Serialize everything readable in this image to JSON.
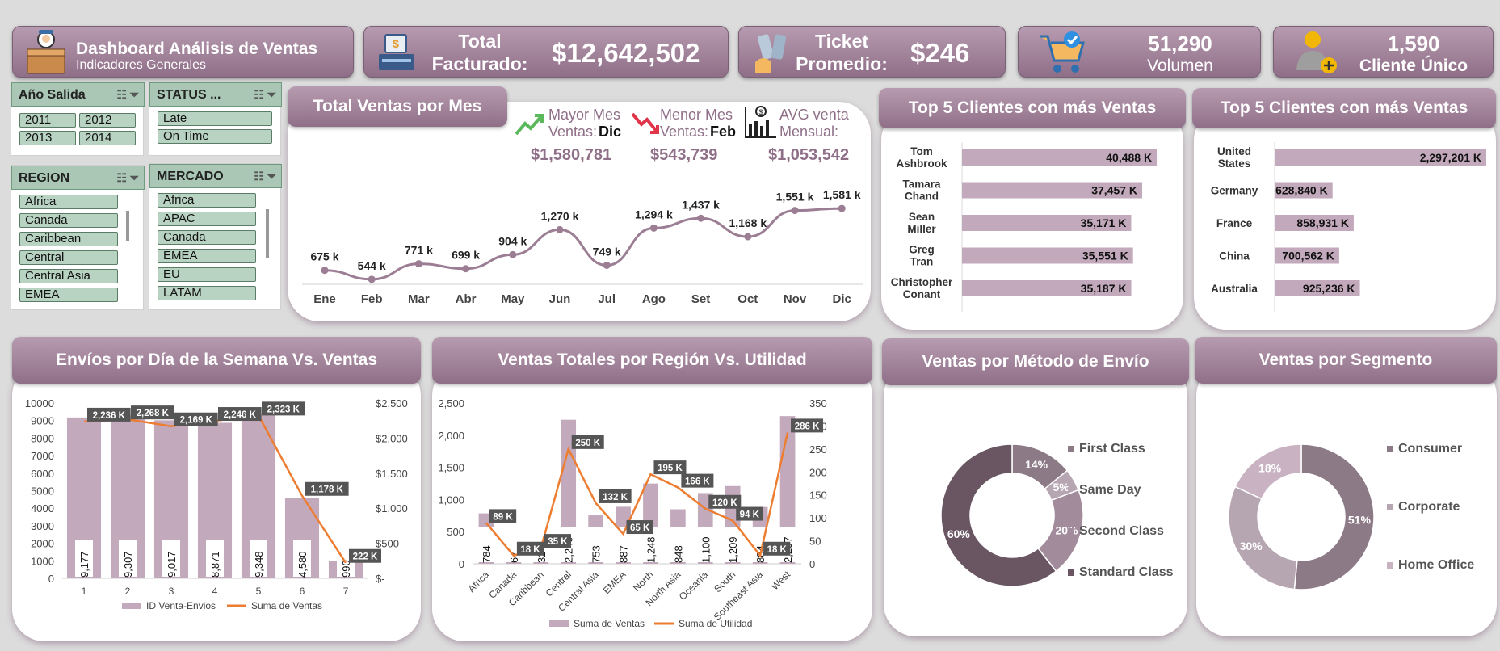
{
  "header": {
    "title": "Dashboard Análisis de Ventas",
    "subtitle": "Indicadores Generales"
  },
  "kpis": {
    "total": {
      "label1": "Total",
      "label2": "Facturado:",
      "value": "$12,642,502"
    },
    "ticket": {
      "label1": "Ticket",
      "label2": "Promedio:",
      "value": "$246"
    },
    "volumen": {
      "value": "51,290",
      "label": "Volumen"
    },
    "clientes": {
      "value": "1,590",
      "label": "Cliente Único"
    }
  },
  "slicers": {
    "anio": {
      "title": "Año Salida",
      "items": [
        "2011",
        "2012",
        "2013",
        "2014"
      ]
    },
    "status": {
      "title": "STATUS ...",
      "items": [
        "Late",
        "On Time"
      ]
    },
    "region": {
      "title": "REGION",
      "items": [
        "Africa",
        "Canada",
        "Caribbean",
        "Central",
        "Central Asia",
        "EMEA"
      ]
    },
    "mercado": {
      "title": "MERCADO",
      "items": [
        "Africa",
        "APAC",
        "Canada",
        "EMEA",
        "EU",
        "LATAM"
      ]
    }
  },
  "monthly": {
    "title": "Total Ventas por Mes",
    "mayor": {
      "l1": "Mayor Mes",
      "l2": "Ventas:",
      "mes": "Dic",
      "value": "$1,580,781"
    },
    "menor": {
      "l1": "Menor Mes",
      "l2": "Ventas:",
      "mes": "Feb",
      "value": "$543,739"
    },
    "avg": {
      "l1": "AVG venta",
      "l2": "Mensual:",
      "value": "$1,053,542"
    }
  },
  "top_clients_title": "Top 5 Clientes con más Ventas",
  "top_countries_title": "Top 5 Clientes con más Ventas",
  "weekday_title": "Envíos por Día de la Semana Vs. Ventas",
  "region_title": "Ventas Totales por Región Vs. Utilidad",
  "ship_title": "Ventas por Método de Envío",
  "segment_title": "Ventas por Segmento",
  "colors": {
    "accent": "#8f6f88",
    "line": "#ed7d31",
    "bar": "#c3a9bc",
    "slicer": "#b8d3c2"
  },
  "chart_data": [
    {
      "id": "monthly",
      "type": "line",
      "categories": [
        "Ene",
        "Feb",
        "Mar",
        "Abr",
        "May",
        "Jun",
        "Jul",
        "Ago",
        "Set",
        "Oct",
        "Nov",
        "Dic"
      ],
      "values": [
        675,
        544,
        771,
        699,
        904,
        1270,
        749,
        1294,
        1437,
        1168,
        1551,
        1581
      ],
      "labels": [
        "675 k",
        "544 k",
        "771 k",
        "699 k",
        "904 k",
        "1,270 k",
        "749 k",
        "1,294 k",
        "1,437 k",
        "1,168 k",
        "1,551 k",
        "1,581 k"
      ]
    },
    {
      "id": "top_clients",
      "type": "bar",
      "categories": [
        "Tom Ashbrook",
        "Tamara Chand",
        "Sean Miller",
        "Greg Tran",
        "Christopher Conant"
      ],
      "values": [
        40488,
        37457,
        35171,
        35551,
        35187
      ],
      "labels": [
        "40,488 K",
        "37,457 K",
        "35,171 K",
        "35,551 K",
        "35,187 K"
      ]
    },
    {
      "id": "top_countries",
      "type": "bar",
      "categories": [
        "United States",
        "Germany",
        "France",
        "China",
        "Australia"
      ],
      "values": [
        2297201,
        628840,
        858931,
        700562,
        925236
      ],
      "labels": [
        "2,297,201 K",
        "628,840 K",
        "858,931 K",
        "700,562 K",
        "925,236 K"
      ]
    },
    {
      "id": "weekday",
      "type": "bar",
      "categories": [
        "1",
        "2",
        "3",
        "4",
        "5",
        "6",
        "7"
      ],
      "series": [
        {
          "name": "ID Venta-Envios",
          "values": [
            9177,
            9307,
            9017,
            8871,
            9348,
            4580,
            990
          ],
          "labels": [
            "9,177",
            "9,307",
            "9,017",
            "8,871",
            "9,348",
            "4,580",
            "990"
          ]
        },
        {
          "name": "Suma de Ventas",
          "values": [
            2236,
            2268,
            2169,
            2246,
            2323,
            1178,
            222
          ],
          "labels": [
            "2,236 K",
            "2,268 K",
            "2,169 K",
            "2,246 K",
            "2,323 K",
            "1,178 K",
            "222 K"
          ]
        }
      ],
      "y_ticks": [
        "0",
        "1000",
        "2000",
        "3000",
        "4000",
        "5000",
        "6000",
        "7000",
        "8000",
        "9000",
        "10000"
      ],
      "y2_ticks": [
        "$-",
        "$500",
        "$1,000",
        "$1,500",
        "$2,000",
        "$2,500"
      ],
      "ylim": [
        0,
        10000
      ],
      "y2lim": [
        0,
        2500
      ]
    },
    {
      "id": "region",
      "type": "bar",
      "categories": [
        "Africa",
        "Canada",
        "Caribbean",
        "Central",
        "Central Asia",
        "EMEA",
        "North",
        "North Asia",
        "Oceania",
        "South",
        "Southeast Asia",
        "West"
      ],
      "series": [
        {
          "name": "Suma de Ventas",
          "values": [
            784,
            67,
            324,
            2240,
            753,
            887,
            1248,
            848,
            1100,
            1209,
            884,
            2297
          ],
          "labels": [
            "784",
            "67",
            "324",
            "2,240",
            "753",
            "887",
            "1,248",
            "848",
            "1,100",
            "1,209",
            "884",
            "2,297"
          ]
        },
        {
          "name": "Suma de Utilidad",
          "values": [
            89,
            18,
            35,
            250,
            132,
            65,
            195,
            166,
            120,
            94,
            18,
            286
          ],
          "labels": [
            "89 K",
            "18 K",
            "35 K",
            "250 K",
            "132 K",
            "65 K",
            "195 K",
            "166 K",
            "120 K",
            "94 K",
            "18 K",
            "286 K"
          ]
        }
      ],
      "y_ticks": [
        "0",
        "500",
        "1,000",
        "1,500",
        "2,000",
        "2,500"
      ],
      "y2_ticks": [
        "0",
        "50",
        "100",
        "150",
        "200",
        "250",
        "300",
        "350"
      ],
      "ylim": [
        0,
        2500
      ],
      "y2lim": [
        0,
        350
      ]
    },
    {
      "id": "ship",
      "type": "pie",
      "categories": [
        "First Class",
        "Same Day",
        "Second Class",
        "Standard Class"
      ],
      "values": [
        14,
        5,
        20,
        60
      ],
      "labels": [
        "14%",
        "5%",
        "20%",
        "60%"
      ],
      "colors": [
        "#8c7a86",
        "#b6a6b1",
        "#a28b9b",
        "#6a5663"
      ]
    },
    {
      "id": "segment",
      "type": "pie",
      "categories": [
        "Consumer",
        "Corporate",
        "Home Office"
      ],
      "values": [
        51,
        30,
        18
      ],
      "labels": [
        "51%",
        "30%",
        "18%"
      ],
      "colors": [
        "#8c7a86",
        "#b6a6b1",
        "#c9b3c3"
      ]
    }
  ]
}
